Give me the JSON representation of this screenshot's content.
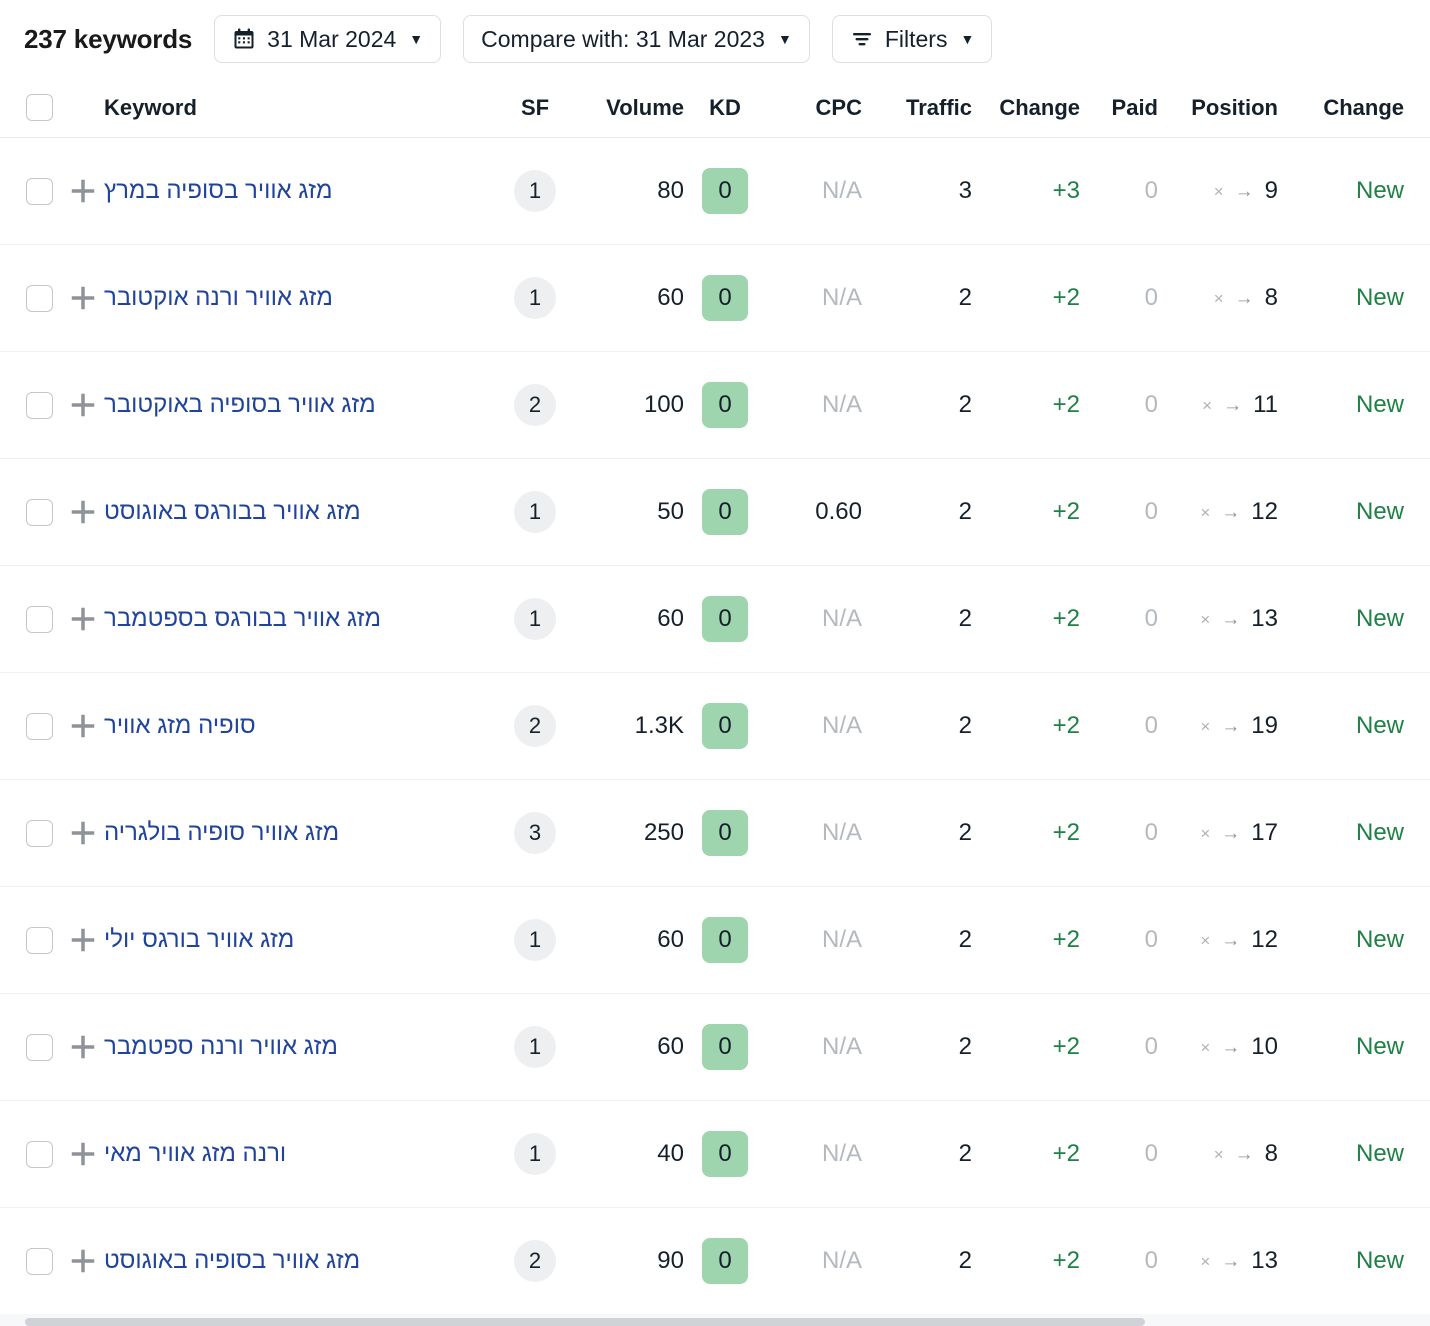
{
  "toolbar": {
    "keywords_count_label": "237 keywords",
    "date_button": {
      "label": "31 Mar 2024",
      "icon": "calendar-icon",
      "caret": "▼"
    },
    "compare_button": {
      "label": "Compare with: 31 Mar 2023",
      "caret": "▼"
    },
    "filters_button": {
      "label": "Filters",
      "icon": "filter-icon",
      "caret": "▼"
    }
  },
  "table": {
    "columns": {
      "keyword": "Keyword",
      "sf": "SF",
      "volume": "Volume",
      "kd": "KD",
      "cpc": "CPC",
      "traffic": "Traffic",
      "traffic_change": "Change",
      "paid": "Paid",
      "position": "Position",
      "position_change": "Change"
    },
    "icons": {
      "add_keyword": "plus-icon",
      "position_from": "×",
      "position_arrow": "→"
    },
    "colors": {
      "keyword_link": "#20449b",
      "kd_badge_bg": "#9ed4ae",
      "positive_change": "#1e8145",
      "muted": "#b4b9be"
    },
    "rows": [
      {
        "keyword": "מזג אוויר בסופיה במרץ",
        "sf": "1",
        "volume": "80",
        "kd": "0",
        "cpc": "N/A",
        "traffic": "3",
        "traffic_change": "+3",
        "paid": "0",
        "position_from": "×",
        "position": "9",
        "position_change": "New"
      },
      {
        "keyword": "מזג אוויר ורנה אוקטובר",
        "sf": "1",
        "volume": "60",
        "kd": "0",
        "cpc": "N/A",
        "traffic": "2",
        "traffic_change": "+2",
        "paid": "0",
        "position_from": "×",
        "position": "8",
        "position_change": "New"
      },
      {
        "keyword": "מזג אוויר בסופיה באוקטובר",
        "sf": "2",
        "volume": "100",
        "kd": "0",
        "cpc": "N/A",
        "traffic": "2",
        "traffic_change": "+2",
        "paid": "0",
        "position_from": "×",
        "position": "11",
        "position_change": "New"
      },
      {
        "keyword": "מזג אוויר בבורגס באוגוסט",
        "sf": "1",
        "volume": "50",
        "kd": "0",
        "cpc": "0.60",
        "traffic": "2",
        "traffic_change": "+2",
        "paid": "0",
        "position_from": "×",
        "position": "12",
        "position_change": "New"
      },
      {
        "keyword": "מזג אוויר בבורגס בספטמבר",
        "sf": "1",
        "volume": "60",
        "kd": "0",
        "cpc": "N/A",
        "traffic": "2",
        "traffic_change": "+2",
        "paid": "0",
        "position_from": "×",
        "position": "13",
        "position_change": "New"
      },
      {
        "keyword": "סופיה מזג אוויר",
        "sf": "2",
        "volume": "1.3K",
        "kd": "0",
        "cpc": "N/A",
        "traffic": "2",
        "traffic_change": "+2",
        "paid": "0",
        "position_from": "×",
        "position": "19",
        "position_change": "New"
      },
      {
        "keyword": "מזג אוויר סופיה בולגריה",
        "sf": "3",
        "volume": "250",
        "kd": "0",
        "cpc": "N/A",
        "traffic": "2",
        "traffic_change": "+2",
        "paid": "0",
        "position_from": "×",
        "position": "17",
        "position_change": "New"
      },
      {
        "keyword": "מזג אוויר בורגס יולי",
        "sf": "1",
        "volume": "60",
        "kd": "0",
        "cpc": "N/A",
        "traffic": "2",
        "traffic_change": "+2",
        "paid": "0",
        "position_from": "×",
        "position": "12",
        "position_change": "New"
      },
      {
        "keyword": "מזג אוויר ורנה ספטמבר",
        "sf": "1",
        "volume": "60",
        "kd": "0",
        "cpc": "N/A",
        "traffic": "2",
        "traffic_change": "+2",
        "paid": "0",
        "position_from": "×",
        "position": "10",
        "position_change": "New"
      },
      {
        "keyword": "ורנה מזג אוויר מאי",
        "sf": "1",
        "volume": "40",
        "kd": "0",
        "cpc": "N/A",
        "traffic": "2",
        "traffic_change": "+2",
        "paid": "0",
        "position_from": "×",
        "position": "8",
        "position_change": "New"
      },
      {
        "keyword": "מזג אוויר בסופיה באוגוסט",
        "sf": "2",
        "volume": "90",
        "kd": "0",
        "cpc": "N/A",
        "traffic": "2",
        "traffic_change": "+2",
        "paid": "0",
        "position_from": "×",
        "position": "13",
        "position_change": "New"
      }
    ]
  }
}
